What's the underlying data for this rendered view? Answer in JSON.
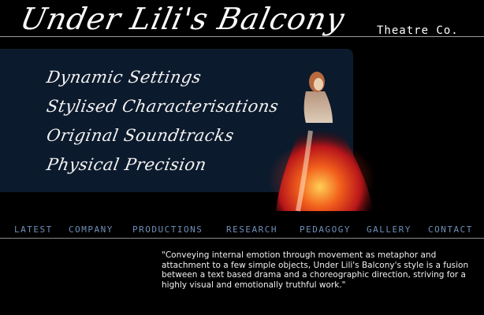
{
  "header": {
    "title": "Under Lili's Balcony",
    "subtitle": "Theatre Co."
  },
  "hero": {
    "taglines": [
      "Dynamic Settings",
      "Stylised Characterisations",
      "Original Soundtracks",
      "Physical Precision"
    ]
  },
  "nav": {
    "items": [
      "LATEST",
      "COMPANY",
      "PRODUCTIONS",
      "RESEARCH",
      "PEDAGOGY",
      "GALLERY",
      "CONTACT"
    ]
  },
  "main": {
    "quote": "\"Conveying internal emotion through movement as metaphor and attachment to a few simple objects, Under Lili's Balcony's style is a fusion between a text based drama and a choreographic direction, striving for a highly visual and emotionally truthful work.\""
  },
  "colors": {
    "background": "#000000",
    "panel": "#0c1a2d",
    "nav_text": "#6f8fb8",
    "rule": "#9a9a9a"
  }
}
